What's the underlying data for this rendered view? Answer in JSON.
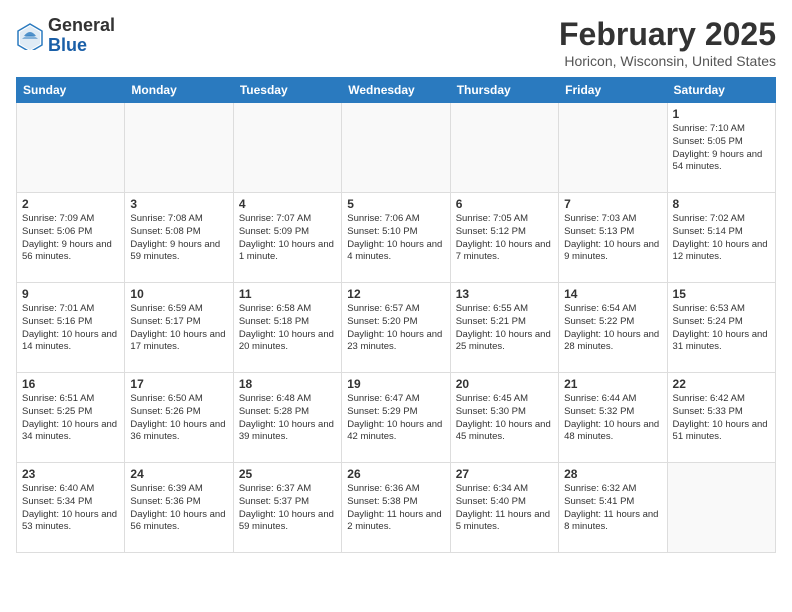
{
  "header": {
    "logo_general": "General",
    "logo_blue": "Blue",
    "title": "February 2025",
    "subtitle": "Horicon, Wisconsin, United States"
  },
  "days_of_week": [
    "Sunday",
    "Monday",
    "Tuesday",
    "Wednesday",
    "Thursday",
    "Friday",
    "Saturday"
  ],
  "weeks": [
    [
      {
        "day": "",
        "info": "",
        "empty": true
      },
      {
        "day": "",
        "info": "",
        "empty": true
      },
      {
        "day": "",
        "info": "",
        "empty": true
      },
      {
        "day": "",
        "info": "",
        "empty": true
      },
      {
        "day": "",
        "info": "",
        "empty": true
      },
      {
        "day": "",
        "info": "",
        "empty": true
      },
      {
        "day": "1",
        "info": "Sunrise: 7:10 AM\nSunset: 5:05 PM\nDaylight: 9 hours and 54 minutes."
      }
    ],
    [
      {
        "day": "2",
        "info": "Sunrise: 7:09 AM\nSunset: 5:06 PM\nDaylight: 9 hours and 56 minutes."
      },
      {
        "day": "3",
        "info": "Sunrise: 7:08 AM\nSunset: 5:08 PM\nDaylight: 9 hours and 59 minutes."
      },
      {
        "day": "4",
        "info": "Sunrise: 7:07 AM\nSunset: 5:09 PM\nDaylight: 10 hours and 1 minute."
      },
      {
        "day": "5",
        "info": "Sunrise: 7:06 AM\nSunset: 5:10 PM\nDaylight: 10 hours and 4 minutes."
      },
      {
        "day": "6",
        "info": "Sunrise: 7:05 AM\nSunset: 5:12 PM\nDaylight: 10 hours and 7 minutes."
      },
      {
        "day": "7",
        "info": "Sunrise: 7:03 AM\nSunset: 5:13 PM\nDaylight: 10 hours and 9 minutes."
      },
      {
        "day": "8",
        "info": "Sunrise: 7:02 AM\nSunset: 5:14 PM\nDaylight: 10 hours and 12 minutes."
      }
    ],
    [
      {
        "day": "9",
        "info": "Sunrise: 7:01 AM\nSunset: 5:16 PM\nDaylight: 10 hours and 14 minutes."
      },
      {
        "day": "10",
        "info": "Sunrise: 6:59 AM\nSunset: 5:17 PM\nDaylight: 10 hours and 17 minutes."
      },
      {
        "day": "11",
        "info": "Sunrise: 6:58 AM\nSunset: 5:18 PM\nDaylight: 10 hours and 20 minutes."
      },
      {
        "day": "12",
        "info": "Sunrise: 6:57 AM\nSunset: 5:20 PM\nDaylight: 10 hours and 23 minutes."
      },
      {
        "day": "13",
        "info": "Sunrise: 6:55 AM\nSunset: 5:21 PM\nDaylight: 10 hours and 25 minutes."
      },
      {
        "day": "14",
        "info": "Sunrise: 6:54 AM\nSunset: 5:22 PM\nDaylight: 10 hours and 28 minutes."
      },
      {
        "day": "15",
        "info": "Sunrise: 6:53 AM\nSunset: 5:24 PM\nDaylight: 10 hours and 31 minutes."
      }
    ],
    [
      {
        "day": "16",
        "info": "Sunrise: 6:51 AM\nSunset: 5:25 PM\nDaylight: 10 hours and 34 minutes."
      },
      {
        "day": "17",
        "info": "Sunrise: 6:50 AM\nSunset: 5:26 PM\nDaylight: 10 hours and 36 minutes."
      },
      {
        "day": "18",
        "info": "Sunrise: 6:48 AM\nSunset: 5:28 PM\nDaylight: 10 hours and 39 minutes."
      },
      {
        "day": "19",
        "info": "Sunrise: 6:47 AM\nSunset: 5:29 PM\nDaylight: 10 hours and 42 minutes."
      },
      {
        "day": "20",
        "info": "Sunrise: 6:45 AM\nSunset: 5:30 PM\nDaylight: 10 hours and 45 minutes."
      },
      {
        "day": "21",
        "info": "Sunrise: 6:44 AM\nSunset: 5:32 PM\nDaylight: 10 hours and 48 minutes."
      },
      {
        "day": "22",
        "info": "Sunrise: 6:42 AM\nSunset: 5:33 PM\nDaylight: 10 hours and 51 minutes."
      }
    ],
    [
      {
        "day": "23",
        "info": "Sunrise: 6:40 AM\nSunset: 5:34 PM\nDaylight: 10 hours and 53 minutes."
      },
      {
        "day": "24",
        "info": "Sunrise: 6:39 AM\nSunset: 5:36 PM\nDaylight: 10 hours and 56 minutes."
      },
      {
        "day": "25",
        "info": "Sunrise: 6:37 AM\nSunset: 5:37 PM\nDaylight: 10 hours and 59 minutes."
      },
      {
        "day": "26",
        "info": "Sunrise: 6:36 AM\nSunset: 5:38 PM\nDaylight: 11 hours and 2 minutes."
      },
      {
        "day": "27",
        "info": "Sunrise: 6:34 AM\nSunset: 5:40 PM\nDaylight: 11 hours and 5 minutes."
      },
      {
        "day": "28",
        "info": "Sunrise: 6:32 AM\nSunset: 5:41 PM\nDaylight: 11 hours and 8 minutes."
      },
      {
        "day": "",
        "info": "",
        "empty": true
      }
    ]
  ]
}
